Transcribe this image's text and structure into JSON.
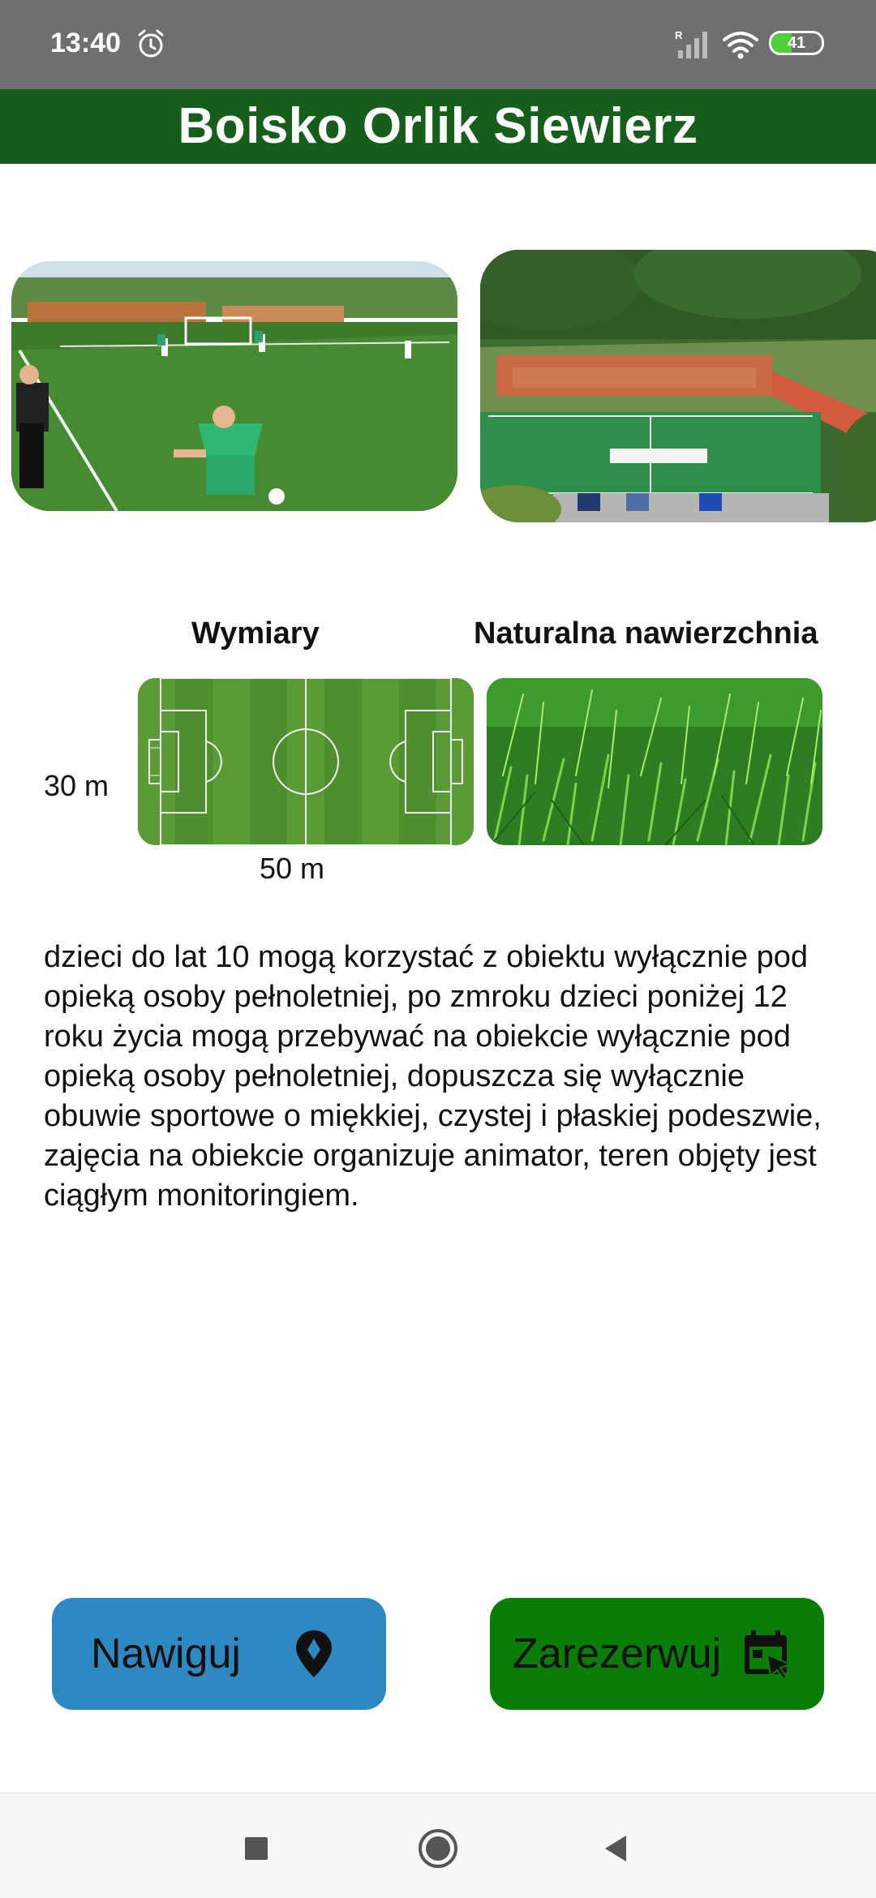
{
  "status_bar": {
    "time": "13:40",
    "battery_level": "41",
    "battery_fraction": 0.41,
    "icons": [
      "alarm-icon",
      "signal-icon",
      "wifi-icon",
      "battery-icon"
    ]
  },
  "header": {
    "title": "Boisko Orlik Siewierz",
    "color": "#175e1d"
  },
  "photos": [
    "photo-kids-playing-football",
    "photo-orlik-field-aerial"
  ],
  "dimensions": {
    "heading": "Wymiary",
    "height_label": "30 m",
    "width_label": "50 m",
    "diagram_icon": "football-pitch-diagram"
  },
  "surface": {
    "heading": "Naturalna nawierzchnia",
    "image_icon": "grass-image"
  },
  "description": "dzieci do lat 10 mogą korzystać z obiektu wyłącznie pod opieką osoby pełnoletniej, po zmroku dzieci poniżej 12 roku życia mogą przebywać na obiekcie wyłącznie pod opieką osoby pełnoletniej, dopuszcza się wyłącznie obuwie sportowe o miękkiej, czystej i płaskiej podeszwie, zajęcia na obiekcie organizuje animator, teren objęty jest ciągłym monitoringiem.",
  "buttons": {
    "navigate": {
      "label": "Nawiguj",
      "icon": "map-pin-icon",
      "color": "#2e88c2"
    },
    "reserve": {
      "label": "Zarezerwuj",
      "icon": "calendar-click-icon",
      "color": "#0a7c08"
    }
  },
  "nav_bar": {
    "icons": [
      "recents-square-icon",
      "home-circle-icon",
      "back-triangle-icon"
    ]
  }
}
